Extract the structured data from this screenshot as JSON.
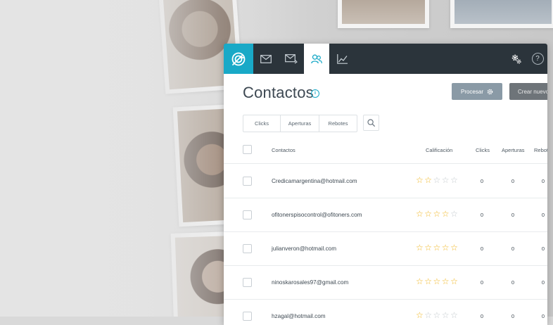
{
  "app": {
    "nav": {
      "tabs": [
        {
          "icon": "logo-icon"
        },
        {
          "icon": "mail-icon"
        },
        {
          "icon": "send-mail-icon"
        },
        {
          "icon": "contacts-icon",
          "active": true
        },
        {
          "icon": "stats-icon"
        }
      ],
      "right_icons": [
        "settings-icon",
        "help-icon"
      ],
      "help_label": "?"
    },
    "page": {
      "title": "Contactos",
      "info_label": "i"
    },
    "actions": {
      "procesar_label": "Procesar",
      "crear_label": "Crear nuevo"
    },
    "filters": [
      "Clicks",
      "Aperturas",
      "Rebotes"
    ],
    "table": {
      "headers": {
        "contactos": "Contactos",
        "calificacion": "Calificación",
        "clicks": "Clicks",
        "aperturas": "Aperturas",
        "rebotes": "Rebot"
      },
      "rows": [
        {
          "email": "Credicamargentina@hotmail.com",
          "rating": 2,
          "clicks": "0",
          "aperturas": "0",
          "rebotes": "0"
        },
        {
          "email": "ofitonerspisocontrol@ofitoners.com",
          "rating": 4,
          "clicks": "0",
          "aperturas": "0",
          "rebotes": "0"
        },
        {
          "email": "julianveron@hotmail.com",
          "rating": 5,
          "clicks": "0",
          "aperturas": "0",
          "rebotes": "0"
        },
        {
          "email": "ninoskarosales97@gmail.com",
          "rating": 5,
          "clicks": "0",
          "aperturas": "0",
          "rebotes": "0"
        },
        {
          "email": "hzagal@hotmail.com",
          "rating": 1,
          "clicks": "0",
          "aperturas": "0",
          "rebotes": "0"
        }
      ],
      "max_rating": 5
    },
    "colors": {
      "accent": "#19a9c7",
      "topbar": "#2b343b",
      "star": "#f0b41c",
      "procesar_button": "#8a9aa6",
      "crear_button": "#6e7479"
    }
  }
}
